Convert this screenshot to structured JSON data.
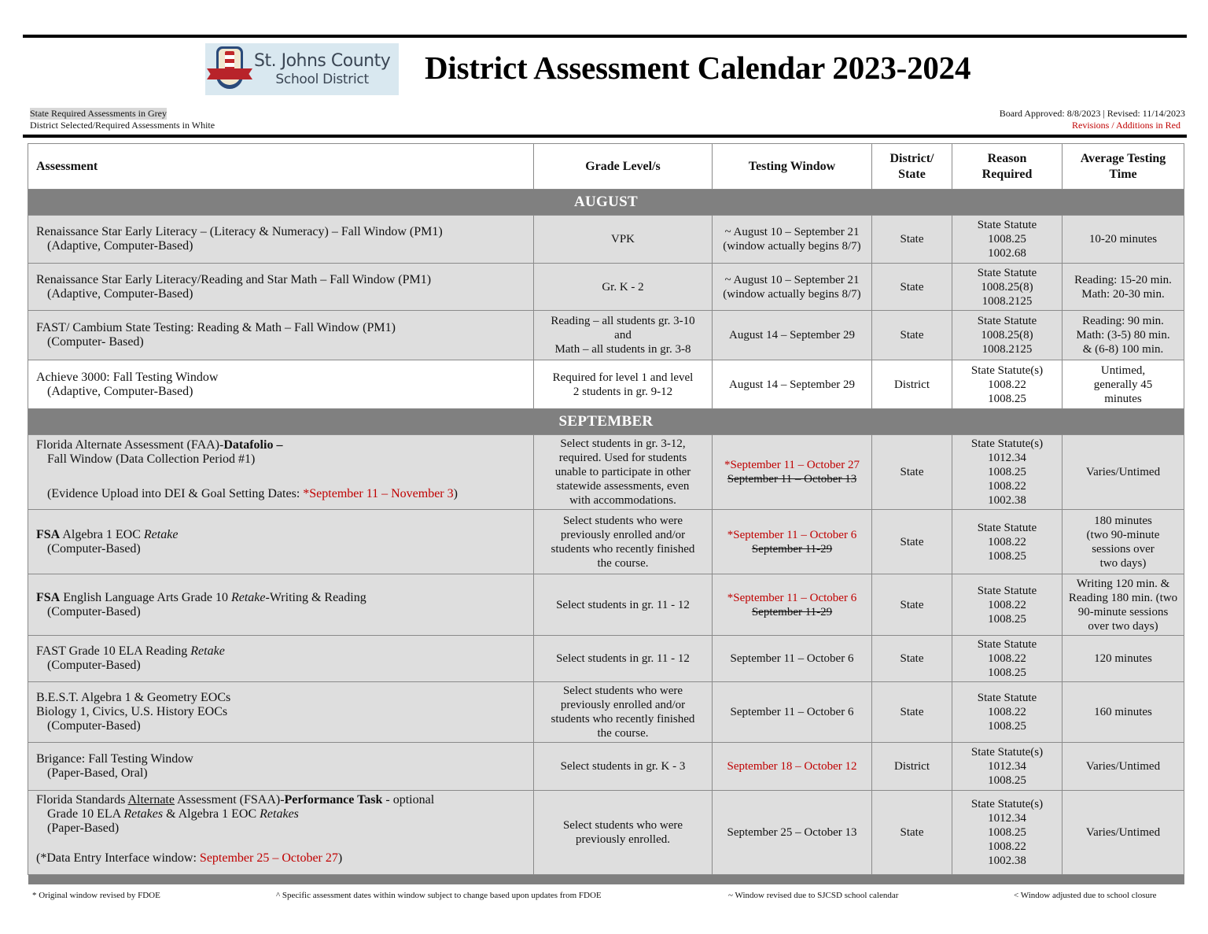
{
  "header": {
    "logo": {
      "line1": "St. Johns County",
      "line2": "School District"
    },
    "title": "District Assessment Calendar 2023-2024",
    "legend_grey": "State Required Assessments in Grey",
    "legend_white": "District Selected/Required Assessments in White",
    "board_approved": "Board Approved:  8/8/2023 |  Revised: 11/14/2023",
    "revisions_note": "Revisions / Additions in Red"
  },
  "colors": {
    "revision_red": "#c00000",
    "month_bar": "#808080",
    "state_row": "#dedede",
    "district_row": "#ffffff"
  },
  "table": {
    "columns": [
      "Assessment",
      "Grade Level/s",
      "Testing Window",
      "District/ State",
      "Reason Required",
      "Average Testing Time"
    ],
    "months": [
      "AUGUST",
      "SEPTEMBER"
    ],
    "august": [
      {
        "line1": "Renaissance Star Early Literacy – (Literacy & Numeracy) – Fall Window (PM1)",
        "line2": "(Adaptive, Computer-Based)",
        "grade": "VPK",
        "window1": "~ August 10 – September 21",
        "window2": "(window actually begins 8/7)",
        "type": "State",
        "reason": [
          "State Statute",
          "1008.25",
          "1002.68"
        ],
        "time": [
          "10-20 minutes"
        ]
      },
      {
        "line1": "Renaissance Star Early Literacy/Reading and Star Math – Fall Window (PM1)",
        "line2": "(Adaptive, Computer-Based)",
        "grade": "Gr. K - 2",
        "window1": "~ August 10 – September 21",
        "window2": "(window actually begins 8/7)",
        "type": "State",
        "reason": [
          "State Statute",
          "1008.25(8)",
          "1008.2125"
        ],
        "time": [
          "Reading: 15-20 min.",
          "Math: 20-30 min."
        ]
      },
      {
        "line1": "FAST/ Cambium State Testing:  Reading & Math – Fall Window (PM1)",
        "line2": "(Computer- Based)",
        "grade": [
          "Reading – all students gr. 3-10",
          "and",
          "Math – all students in gr. 3-8"
        ],
        "window1": "August 14 – September 29",
        "type": "State",
        "reason": [
          "State Statute",
          "1008.25(8)",
          "1008.2125"
        ],
        "time": [
          "Reading: 90 min.",
          "Math: (3-5) 80 min.",
          "& (6-8) 100 min."
        ]
      },
      {
        "line1": "Achieve 3000:  Fall Testing Window",
        "line2": "(Adaptive, Computer-Based)",
        "grade": [
          "Required for level 1 and level",
          "2 students in gr. 9-12"
        ],
        "window1": "August 14 – September 29",
        "type": "District",
        "reason": [
          "State Statute(s)",
          "1008.22",
          "1008.25"
        ],
        "time": [
          "Untimed,",
          "generally 45",
          "minutes"
        ]
      }
    ],
    "september": [
      {
        "line1_pre": "Florida Alternate Assessment (FAA)-",
        "line1_bold": "Datafolio –",
        "line2": "Fall Window (Data Collection Period #1)",
        "line3_pre": "(Evidence Upload into DEI & Goal Setting Dates: ",
        "line3_red": "*September 11 – November 3",
        "line3_post": ")",
        "grade": [
          "Select students in gr. 3-12,",
          "required.  Used for students",
          "unable to participate in other",
          "statewide assessments, even",
          "with accommodations."
        ],
        "window_new": "*September 11 – October 27",
        "window_old": "September 11 – October 13",
        "type": "State",
        "reason": [
          "State Statute(s)",
          "1012.34",
          "1008.25",
          "1008.22",
          "1002.38"
        ],
        "time": [
          "Varies/Untimed"
        ]
      },
      {
        "bold": "FSA",
        "line1_mid": " Algebra 1 EOC ",
        "italic": "Retake",
        "line2": "(Computer-Based)",
        "grade": [
          "Select students who were",
          "previously enrolled and/or",
          "students who recently finished",
          "the course."
        ],
        "window_new": "*September 11 – October 6",
        "window_old": "September 11-29",
        "type": "State",
        "reason": [
          "State Statute",
          "1008.22",
          "1008.25"
        ],
        "time": [
          "180 minutes",
          "(two 90-minute",
          "sessions over",
          "two days)"
        ]
      },
      {
        "bold": "FSA",
        "line1_mid": " English Language Arts Grade 10 ",
        "italic": "Retake",
        "line1_post": "-Writing & Reading",
        "line2": "(Computer-Based)",
        "grade": [
          "Select students in gr. 11 - 12"
        ],
        "window_new": "*September 11 – October 6",
        "window_old": "September 11-29",
        "type": "State",
        "reason": [
          "State Statute",
          "1008.22",
          "1008.25"
        ],
        "time": [
          "Writing 120 min. &",
          "Reading 180 min. (two",
          "90-minute sessions",
          "over two days)"
        ]
      },
      {
        "line1_pre": "FAST Grade 10 ELA Reading ",
        "italic": "Retake",
        "line2": "(Computer-Based)",
        "grade": [
          "Select students in gr. 11 - 12"
        ],
        "window1": "September 11 – October 6",
        "type": "State",
        "reason": [
          "State Statute",
          "1008.22",
          "1008.25"
        ],
        "time": [
          "120 minutes"
        ]
      },
      {
        "line1": "B.E.S.T. Algebra 1 & Geometry EOCs",
        "line1b": "Biology 1, Civics, U.S. History EOCs",
        "line2": "(Computer-Based)",
        "grade": [
          "Select students who were",
          "previously enrolled and/or",
          "students who recently finished",
          "the course."
        ],
        "window1": "September 11 – October 6",
        "type": "State",
        "reason": [
          "State Statute",
          "1008.22",
          "1008.25"
        ],
        "time": [
          "160 minutes"
        ]
      },
      {
        "line1": "Brigance:  Fall Testing Window",
        "line2": "(Paper-Based, Oral)",
        "grade": [
          "Select students in gr. K - 3"
        ],
        "window_red": "September 18 – October 12",
        "type": "District",
        "reason": [
          "State Statute(s)",
          "1012.34",
          "1008.25"
        ],
        "time": [
          "Varies/Untimed"
        ]
      },
      {
        "line1_pre": "Florida Standards ",
        "underline": "Alternate",
        "line1_mid": " Assessment (FSAA)-",
        "line1_bold": "Performance Task",
        "line1_post": " - optional",
        "line2_pre": "Grade 10 ELA ",
        "line2_i1": "Retakes",
        "line2_mid": " & Algebra 1 EOC ",
        "line2_i2": "Retakes",
        "line3": "(Paper-Based)",
        "line4_pre": "(*Data Entry Interface window: ",
        "line4_red": "September 25 – October 27",
        "line4_post": ")",
        "grade": [
          "Select students who were",
          "previously enrolled."
        ],
        "window1": "September 25 – October 13",
        "type": "State",
        "reason": [
          "State Statute(s)",
          "1012.34",
          "1008.25",
          "1008.22",
          "1002.38"
        ],
        "time": [
          "Varies/Untimed"
        ]
      }
    ]
  },
  "footnotes": [
    "* Original window revised by FDOE",
    "^ Specific assessment dates within window subject to change based upon updates from FDOE",
    "~ Window revised due to SJCSD school calendar",
    "< Window adjusted due to school closure"
  ]
}
